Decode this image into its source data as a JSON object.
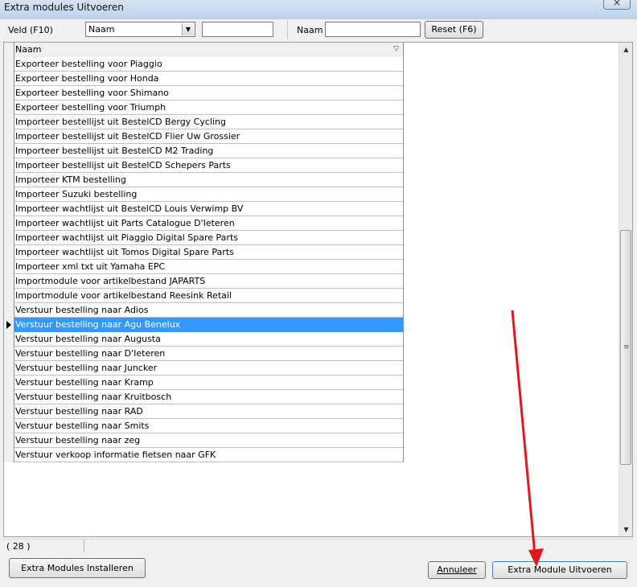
{
  "window": {
    "title": "Extra modules Uitvoeren",
    "close_glyph": "×"
  },
  "toolbar": {
    "field_label": "Veld (F10)",
    "field_select_value": "Naam",
    "field_value": "",
    "name_label": "Naam",
    "name_value": "",
    "reset_label": "Reset (F6)"
  },
  "grid": {
    "column_header": "Naam",
    "selected_index": 18,
    "rows": [
      "Exporteer bestelling voor  Piaggio",
      "Exporteer bestelling voor Honda",
      "Exporteer bestelling voor Shimano",
      "Exporteer bestelling voor Triumph",
      "Importeer bestellijst uit BestelCD Bergy Cycling",
      "Importeer bestellijst uit BestelCD Flier Uw Grossier",
      "Importeer bestellijst uit BestelCD M2 Trading",
      "Importeer bestellijst uit BestelCD Schepers Parts",
      "Importeer KTM bestelling",
      "Importeer Suzuki bestelling",
      "Importeer wachtlijst uit BestelCD Louis Verwimp BV",
      "Importeer wachtlijst uit Parts Catalogue D'Ieteren",
      "Importeer wachtlijst uit Piaggio Digital Spare Parts",
      "Importeer wachtlijst uit Tomos Digital Spare Parts",
      "Importeer xml txt uit Yamaha EPC",
      "Importmodule voor artikelbestand JAPARTS",
      "Importmodule voor artikelbestand Reesink Retail",
      "Verstuur bestelling naar Adios",
      "Verstuur bestelling naar Agu Benelux",
      "Verstuur bestelling naar Augusta",
      "Verstuur bestelling naar D'Ieteren",
      "Verstuur bestelling naar Juncker",
      "Verstuur bestelling naar Kramp",
      "Verstuur bestelling naar Kruitbosch",
      "Verstuur bestelling naar RAD",
      "Verstuur bestelling naar Smits",
      "Verstuur bestelling naar zeg",
      "Verstuur verkoop informatie fietsen naar GFK"
    ]
  },
  "status": {
    "count": "( 28 )"
  },
  "buttons": {
    "install": "Extra Modules Installeren",
    "cancel": "Annuleer",
    "run": "Extra Module Uitvoeren"
  },
  "colors": {
    "selection": "#3399ff",
    "annotation_arrow": "#e8141c"
  }
}
